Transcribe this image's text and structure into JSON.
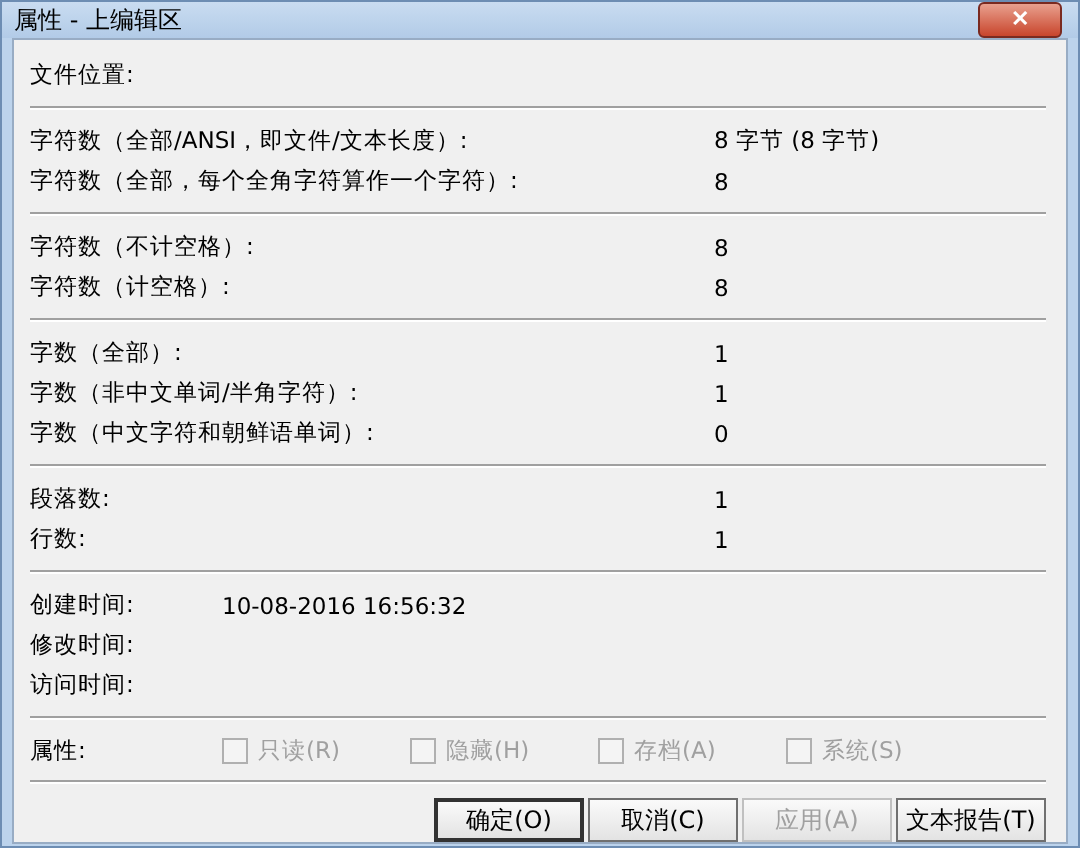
{
  "window": {
    "title": "属性 - 上编辑区",
    "close": "✕"
  },
  "sections": [
    {
      "rows": [
        {
          "label": "文件位置:"
        }
      ]
    },
    {
      "rows": [
        {
          "label": "字符数（全部/ANSI，即文件/文本长度）:",
          "value": "8 字节 (8 字节)"
        },
        {
          "label": "字符数（全部，每个全角字符算作一个字符）:",
          "value": "8"
        }
      ]
    },
    {
      "rows": [
        {
          "label": "字符数（不计空格）:",
          "value": "8"
        },
        {
          "label": "字符数（计空格）:",
          "value": "8"
        }
      ]
    },
    {
      "rows": [
        {
          "label": "字数（全部）:",
          "value": "1"
        },
        {
          "label": "字数（非中文单词/半角字符）:",
          "value": "1"
        },
        {
          "label": "字数（中文字符和朝鲜语单词）:",
          "value": "0"
        }
      ]
    },
    {
      "rows": [
        {
          "label": "段落数:",
          "value": "1"
        },
        {
          "label": "行数:",
          "value": "1"
        }
      ]
    },
    {
      "kind": "times",
      "rows": [
        {
          "label": "创建时间:",
          "value": "10-08-2016 16:56:32"
        },
        {
          "label": "修改时间:"
        },
        {
          "label": "访问时间:"
        }
      ]
    }
  ],
  "attributes": {
    "label": "属性:",
    "options": [
      {
        "label": "只读(R)",
        "checked": false,
        "disabled": true
      },
      {
        "label": "隐藏(H)",
        "checked": false,
        "disabled": true
      },
      {
        "label": "存档(A)",
        "checked": false,
        "disabled": true
      },
      {
        "label": "系统(S)",
        "checked": false,
        "disabled": true
      }
    ]
  },
  "buttons": [
    {
      "label": "确定(O)",
      "disabled": false,
      "default": true
    },
    {
      "label": "取消(C)",
      "disabled": false,
      "default": false
    },
    {
      "label": "应用(A)",
      "disabled": true,
      "default": false
    },
    {
      "label": "文本报告(T)",
      "disabled": false,
      "default": false
    }
  ]
}
